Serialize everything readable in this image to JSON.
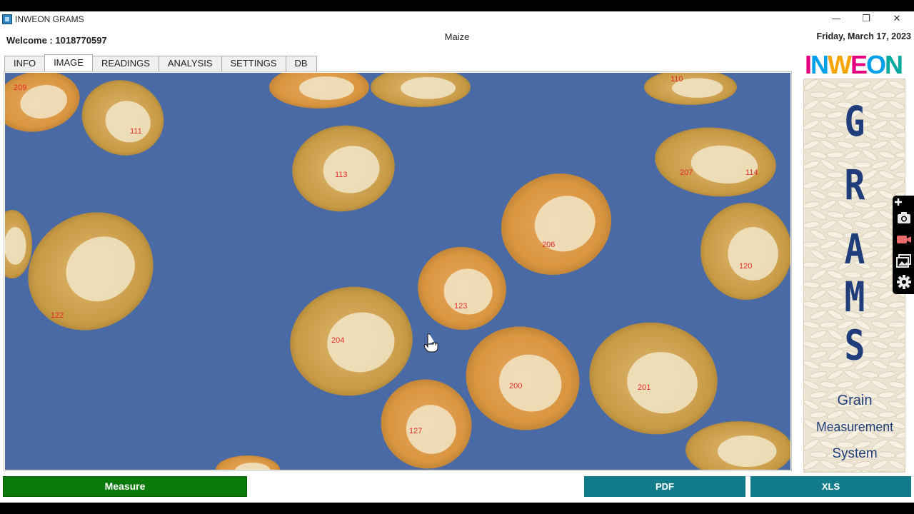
{
  "window": {
    "title": "INWEON GRAMS",
    "controls": {
      "minimize": "—",
      "restore": "❐",
      "close": "✕"
    }
  },
  "header": {
    "welcome": "Welcome : 1018770597",
    "crop": "Maize",
    "date": "Friday, March 17, 2023"
  },
  "tabs": [
    {
      "label": "INFO",
      "active": false
    },
    {
      "label": "IMAGE",
      "active": true
    },
    {
      "label": "READINGS",
      "active": false
    },
    {
      "label": "ANALYSIS",
      "active": false
    },
    {
      "label": "SETTINGS",
      "active": false
    },
    {
      "label": "DB",
      "active": false
    }
  ],
  "image": {
    "background_color": "#4a6aa5",
    "grain_labels": [
      "209",
      "111",
      "110",
      "113",
      "207",
      "114",
      "206",
      "120",
      "122",
      "123",
      "204",
      "200",
      "201",
      "127"
    ]
  },
  "logo": {
    "letters": [
      "I",
      "N",
      "W",
      "E",
      "O",
      "N"
    ],
    "colors": [
      "#e4007c",
      "#00a0e9",
      "#f5a400",
      "#e4007c",
      "#00a0e9",
      "#00a99d"
    ]
  },
  "banner": {
    "letters": [
      "G",
      "R",
      "A",
      "M",
      "S"
    ],
    "line1": "Grain",
    "line2": "Measurement",
    "line3": "System"
  },
  "side_tools": [
    "plus-icon",
    "camera-icon",
    "video-icon",
    "gallery-icon",
    "gear-icon"
  ],
  "buttons": {
    "measure": "Measure",
    "pdf": "PDF",
    "xls": "XLS"
  },
  "colors": {
    "measure": "#0a7a0a",
    "export": "#137c8a",
    "label": "#e52a2a"
  }
}
